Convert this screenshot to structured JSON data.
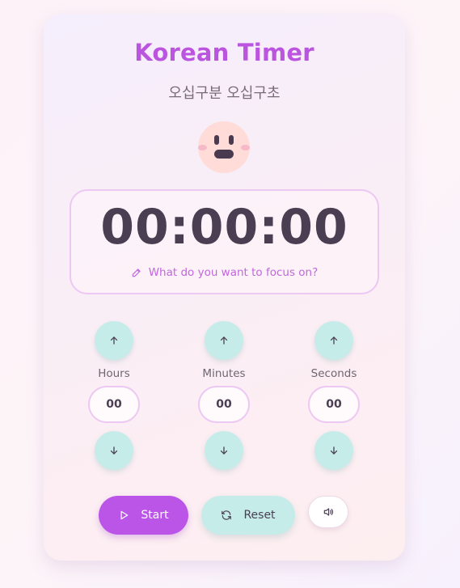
{
  "app": {
    "title": "Korean Timer",
    "subtitle": "오십구분 오십구초"
  },
  "display": {
    "time": "00:00:00",
    "focus_placeholder": "What do you want to focus on?"
  },
  "controls": {
    "hours": {
      "label": "Hours",
      "value": "00"
    },
    "minutes": {
      "label": "Minutes",
      "value": "00"
    },
    "seconds": {
      "label": "Seconds",
      "value": "00"
    }
  },
  "actions": {
    "start_label": "Start",
    "reset_label": "Reset"
  },
  "icons": {
    "mascot": "smiley-face-icon",
    "focus": "pencil-icon",
    "increment": "arrow-up-icon",
    "decrement": "arrow-down-icon",
    "start": "play-icon",
    "reset": "refresh-icon",
    "sound": "speaker-icon"
  },
  "colors": {
    "accent": "#bb55e0",
    "start_button": "#bb55e8",
    "mint_button": "#c6ecea",
    "mascot_face": "#ffdcd8",
    "time_text": "#4a3f52"
  }
}
